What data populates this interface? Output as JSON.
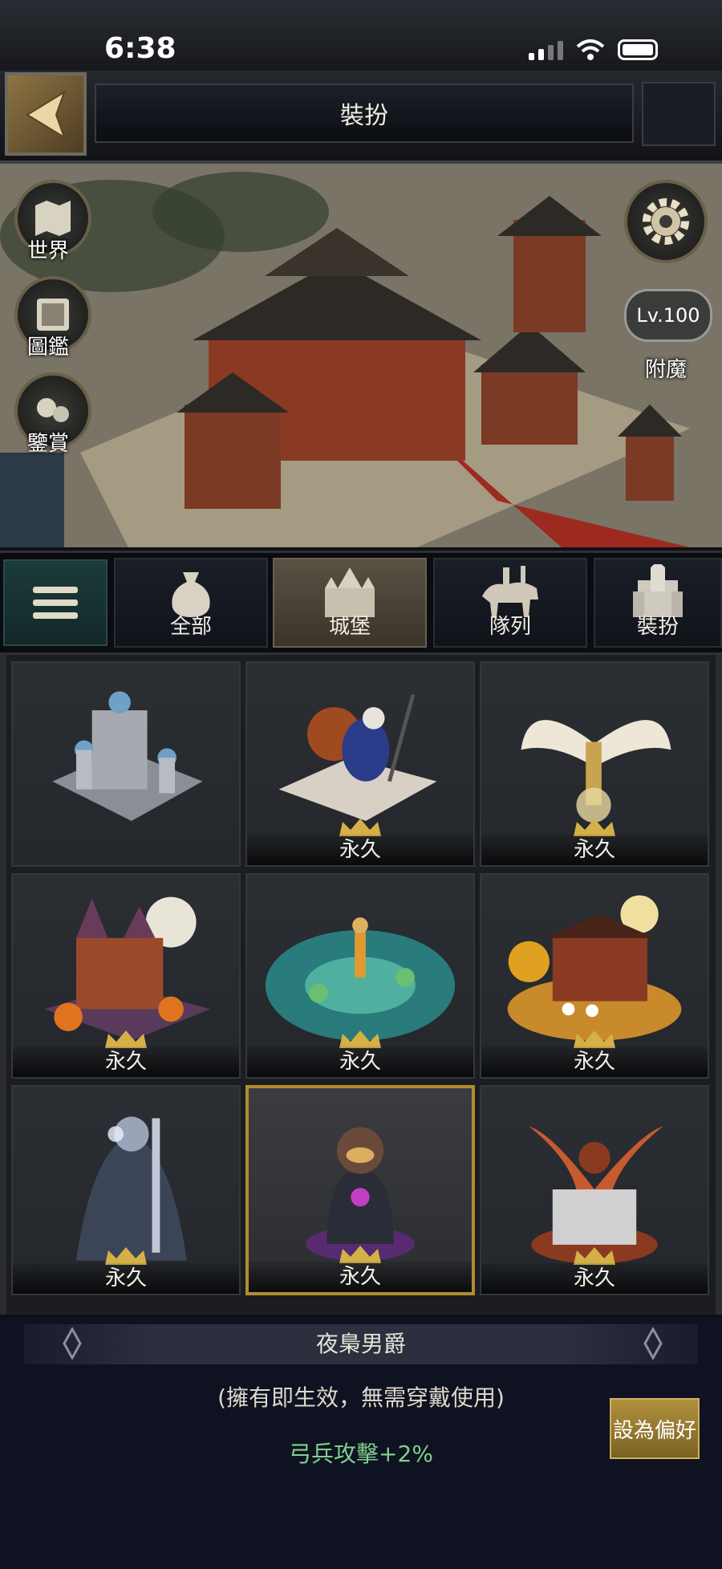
{
  "status_bar": {
    "time": "6:38"
  },
  "header": {
    "title": "裝扮"
  },
  "scene": {
    "side_buttons": [
      {
        "label": "世界",
        "icon": "world-map-icon"
      },
      {
        "label": "圖鑑",
        "icon": "codex-book-icon"
      },
      {
        "label": "鑒賞",
        "icon": "appreciate-icon"
      }
    ],
    "settings_icon": "gear-icon",
    "level_badge": "Lv.100",
    "enchant_label": "附魔"
  },
  "tabs": [
    {
      "label": "全部",
      "icon": "money-bag-icon",
      "active": false
    },
    {
      "label": "城堡",
      "icon": "castle-icon",
      "active": true
    },
    {
      "label": "隊列",
      "icon": "cavalry-icon",
      "active": false
    },
    {
      "label": "裝扮",
      "icon": "outfit-icon",
      "active": false
    }
  ],
  "items": [
    {
      "label": "",
      "theme": "ice-castle"
    },
    {
      "label": "永久",
      "theme": "turkey-fortress"
    },
    {
      "label": "永久",
      "theme": "angel-wings"
    },
    {
      "label": "永久",
      "theme": "halloween-castle"
    },
    {
      "label": "永久",
      "theme": "lotus-pond"
    },
    {
      "label": "永久",
      "theme": "moon-festival"
    },
    {
      "label": "永久",
      "theme": "night-knight"
    },
    {
      "label": "永久",
      "theme": "night-owl-baron",
      "selected": true
    },
    {
      "label": "永久",
      "theme": "fire-dragon"
    }
  ],
  "detail": {
    "name": "夜梟男爵",
    "note": "(擁有即生效，無需穿戴使用)",
    "effect": "弓兵攻擊+2%",
    "pref_button": "設為偏好"
  },
  "colors": {
    "accent_gold": "#b08e2e",
    "effect_green": "#7fd08f",
    "selected_border": "#b08e2e"
  }
}
